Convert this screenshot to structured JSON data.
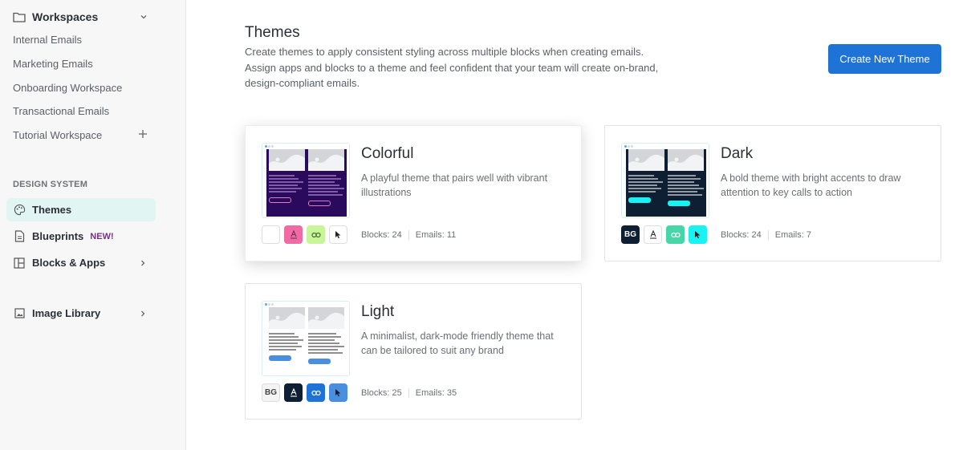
{
  "sidebar": {
    "workspaces": {
      "title": "Workspaces",
      "items": [
        "Internal Emails",
        "Marketing Emails",
        "Onboarding Workspace",
        "Transactional Emails",
        "Tutorial Workspace"
      ]
    },
    "design_system": {
      "label": "DESIGN SYSTEM",
      "items": [
        {
          "label": "Themes",
          "icon": "palette-icon",
          "active": true
        },
        {
          "label": "Blueprints",
          "icon": "document-icon",
          "badge": "NEW!"
        },
        {
          "label": "Blocks & Apps",
          "icon": "layout-icon"
        }
      ]
    },
    "image_library": {
      "label": "Image Library",
      "icon": "image-icon"
    }
  },
  "main": {
    "title": "Themes",
    "description": "Create themes to apply consistent styling across multiple blocks when creating emails. Assign apps and blocks to a theme and feel confident that your team will create on-brand, design-compliant emails.",
    "create_button": "Create New Theme",
    "themes": [
      {
        "name": "Colorful",
        "description": "A playful theme that pairs well with vibrant illustrations",
        "blocks": "Blocks: 24",
        "emails": "Emails: 11",
        "colors": {
          "background": "#2a0a5c",
          "bg_swatch": "#ffffff",
          "text_swatch": "#f06ba4",
          "link_swatch": "#c9f59a",
          "button_swatch": "#ffffff",
          "text": "#c99ee8",
          "button": "#e07ac0"
        },
        "bg_label": ""
      },
      {
        "name": "Dark",
        "description": "A bold theme with bright accents to draw attention to key calls to action",
        "blocks": "Blocks: 24",
        "emails": "Emails: 7",
        "colors": {
          "background": "#0f1f33",
          "bg_swatch": "#0f1f33",
          "text_swatch": "#ffffff",
          "link_swatch": "#48d6a8",
          "button_swatch": "#19f2f2",
          "text": "#ffffff",
          "button": "#19f2f2"
        },
        "bg_label": "BG"
      },
      {
        "name": "Light",
        "description": "A minimalist, dark-mode friendly theme that can be tailored to suit any brand",
        "blocks": "Blocks: 25",
        "emails": "Emails: 35",
        "colors": {
          "background": "#ffffff",
          "bg_swatch": "#f4f4f4",
          "text_swatch": "#0f1f33",
          "link_swatch": "#1f73d6",
          "button_swatch": "#4a8ee0",
          "text": "#333333",
          "button": "#4a8ee0"
        },
        "bg_label": "BG"
      }
    ]
  }
}
